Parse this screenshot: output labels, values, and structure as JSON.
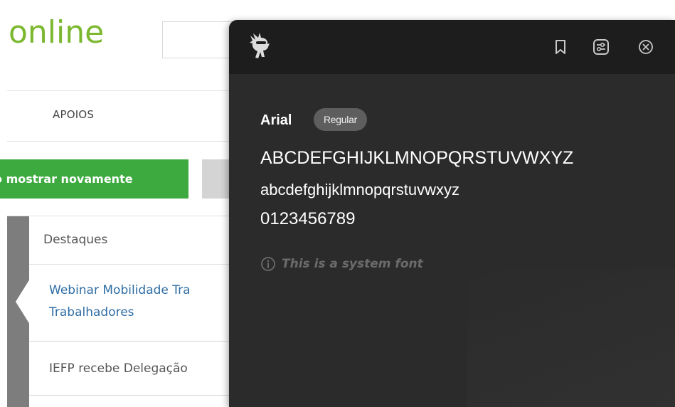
{
  "page": {
    "logo_text": "online",
    "nav": {
      "apoios_label": "APOIOS"
    },
    "buttons": {
      "show_again_label": "o mostrar novamente"
    },
    "list": {
      "heading": "Destaques",
      "items": [
        {
          "line1": "Webinar Mobilidade Tra",
          "line2": "Trabalhadores"
        },
        {
          "line1": "IEFP recebe Delegação"
        }
      ]
    }
  },
  "panel": {
    "font_name": "Arial",
    "style_badge": "Regular",
    "sample_upper": "ABCDEFGHIJKLMNOPQRSTUVWXYZ",
    "sample_lower": "abcdefghijklmnopqrstuvwxyz",
    "sample_digits": "0123456789",
    "system_font_note": "This is a system font",
    "icons": {
      "brand": "ninja-icon",
      "bookmark": "bookmark-icon",
      "settings": "sliders-icon",
      "close": "close-circle-icon"
    }
  },
  "colors": {
    "logo_green": "#7cb82f",
    "button_green": "#3daa3f",
    "link_blue": "#2e6da4",
    "panel_bg": "#2b2b2b",
    "panel_header_bg": "#1d1d1d",
    "badge_bg": "#5e5e5e"
  }
}
